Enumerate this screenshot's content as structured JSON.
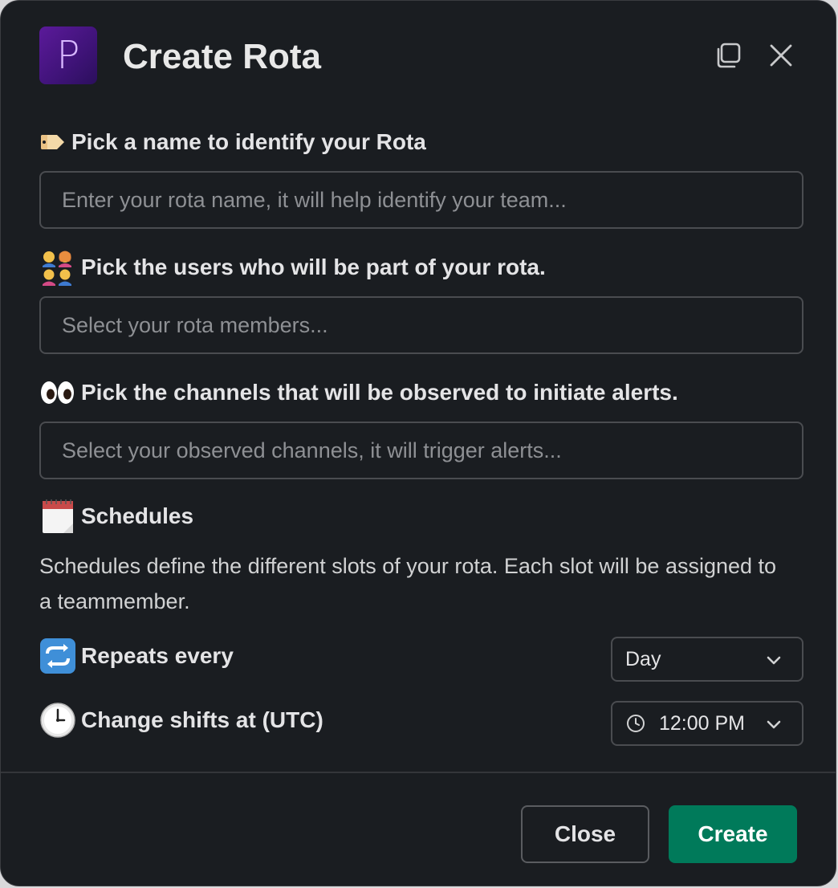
{
  "modal": {
    "title": "Create Rota",
    "logo_letter": "P",
    "header_icons": [
      "expand-icon",
      "close-icon"
    ]
  },
  "fields": {
    "name": {
      "label": "Pick a name to identify your Rota",
      "placeholder": "Enter your rota name, it will help identify your team...",
      "emoji": "label-tag"
    },
    "users": {
      "label": "Pick the users who will be part of your rota.",
      "placeholder": "Select your rota members...",
      "emoji": "family"
    },
    "channels": {
      "label": "Pick the channels that will be observed to initiate alerts.",
      "placeholder": "Select your observed channels, it will trigger alerts...",
      "emoji": "eyes"
    }
  },
  "schedules": {
    "heading": "Schedules",
    "emoji": "spiral-calendar",
    "description": "Schedules define the different slots of your rota. Each slot will be assigned to a teammember.",
    "repeats": {
      "label": "Repeats every",
      "emoji": "repeat",
      "value": "Day"
    },
    "change_shifts": {
      "label": "Change shifts at (UTC)",
      "emoji": "clock",
      "value": "12:00 PM"
    }
  },
  "footer": {
    "close_label": "Close",
    "create_label": "Create",
    "create_color": "#007a5a"
  }
}
